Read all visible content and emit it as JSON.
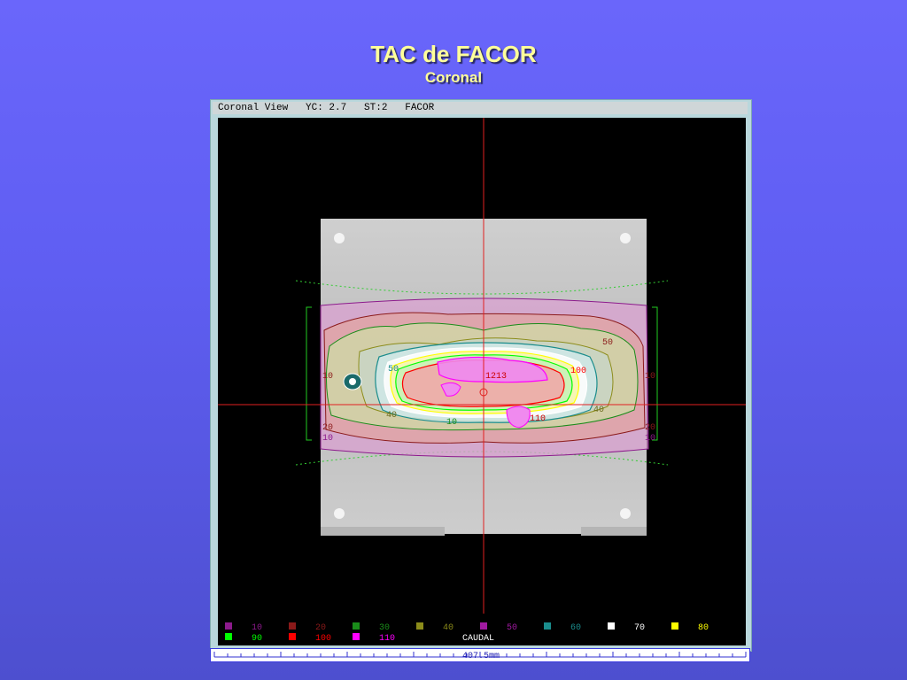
{
  "slide": {
    "title": "TAC  de FACOR",
    "subtitle": "Coronal"
  },
  "viewer": {
    "header": "Coronal View   YC: 2.7   ST:2   FACOR",
    "orientation_label": "CAUDAL",
    "scale_label": "407.5mm",
    "contour_labels": [
      "50",
      "50",
      "100",
      "10",
      "10",
      "1213",
      "40",
      "40",
      "110",
      "20",
      "20",
      "10",
      "10",
      "10"
    ],
    "legend": [
      {
        "label": "10",
        "color": "#8c1a8c"
      },
      {
        "label": "20",
        "color": "#8b1a1a"
      },
      {
        "label": "30",
        "color": "#1a8c1a"
      },
      {
        "label": "40",
        "color": "#8c8c1a"
      },
      {
        "label": "50",
        "color": "#a01aa0"
      },
      {
        "label": "60",
        "color": "#1a8c8c"
      },
      {
        "label": "70",
        "color": "#ffffff"
      },
      {
        "label": "80",
        "color": "#ffff00"
      },
      {
        "label": "90",
        "color": "#00ff00"
      },
      {
        "label": "100",
        "color": "#ff0000"
      },
      {
        "label": "110",
        "color": "#ff00ff"
      }
    ]
  }
}
